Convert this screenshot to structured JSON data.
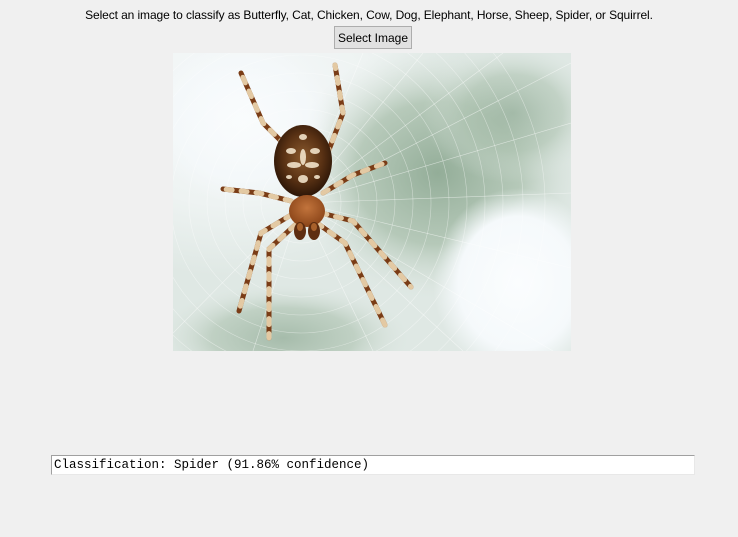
{
  "instructions": "Select an image to classify as Butterfly, Cat, Chicken, Cow, Dog, Elephant, Horse, Sheep, Spider, or Squirrel.",
  "select_button_label": "Select Image",
  "result_text": "Classification: Spider (91.86% confidence)",
  "image": {
    "subject": "spider-on-web-photo"
  }
}
